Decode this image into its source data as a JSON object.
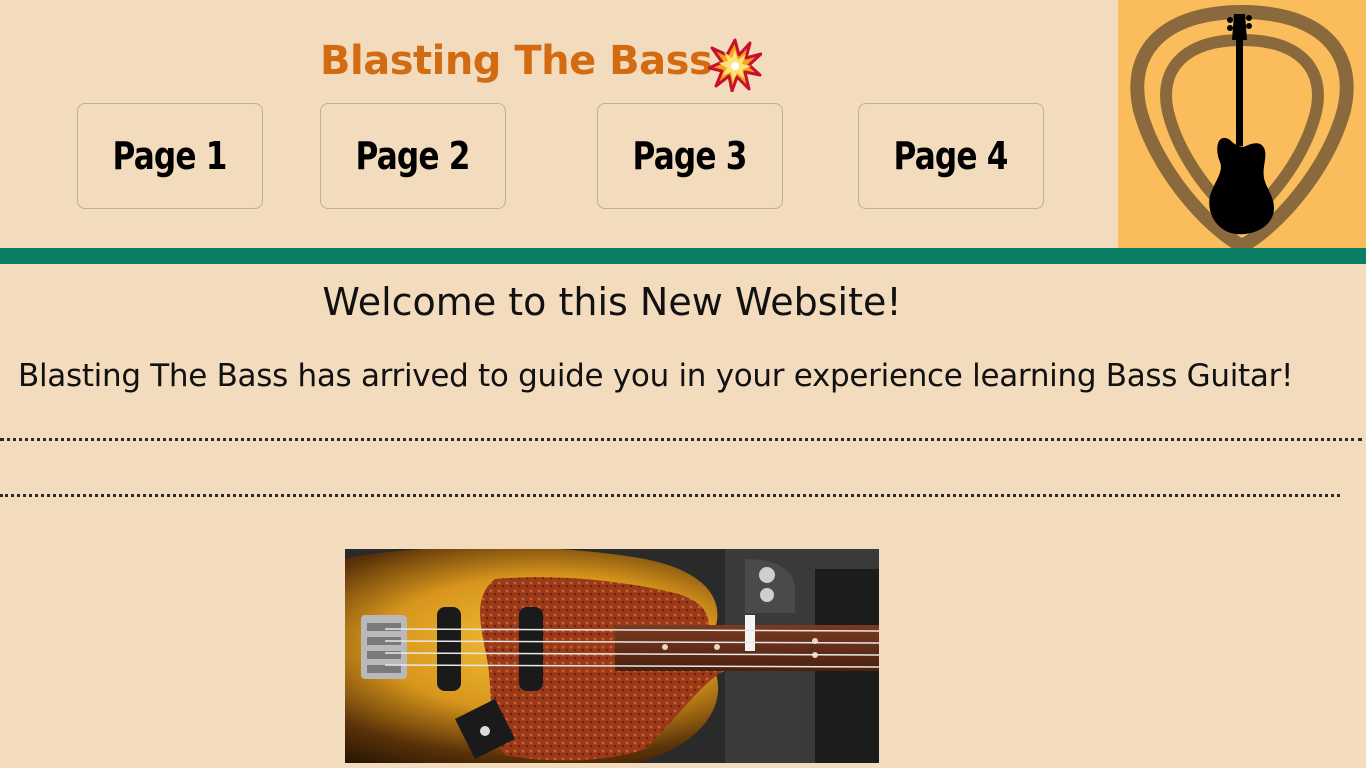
{
  "header": {
    "title": "Blasting The Bass",
    "title_icon": "collision-burst-icon",
    "logo_icon": "bass-guitar-pick-icon"
  },
  "nav": {
    "items": [
      {
        "label": "Page 1"
      },
      {
        "label": "Page 2"
      },
      {
        "label": "Page 3"
      },
      {
        "label": "Page 4"
      }
    ]
  },
  "main": {
    "heading": "Welcome to this New Website!",
    "intro": "Blasting The Bass has arrived to guide you in your experience learning Bass Guitar!",
    "image_icon": "bass-guitar-photo"
  },
  "colors": {
    "background": "#f3dcbd",
    "title": "#d36b12",
    "divider": "#0a7e64",
    "logo_background": "#fbbd5c"
  }
}
